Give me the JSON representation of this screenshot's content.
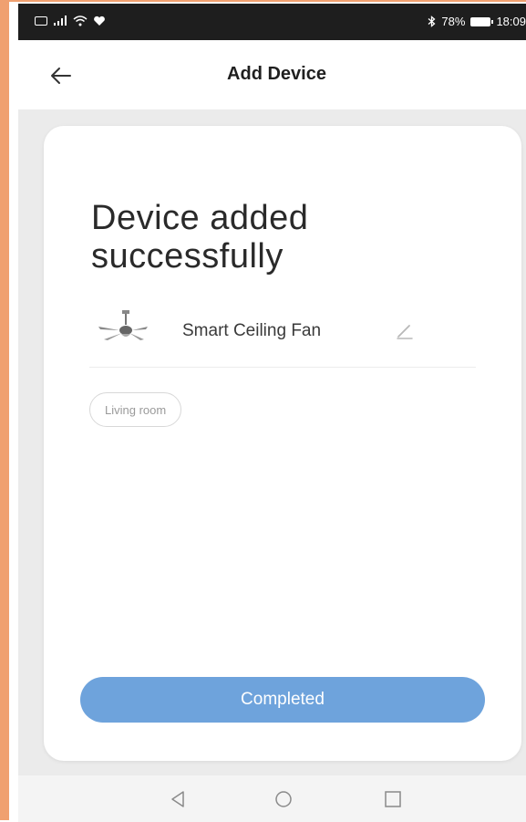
{
  "status_bar": {
    "battery_text": "78%",
    "time": "18:09",
    "icons": [
      "sim-icon",
      "signal-icon",
      "wifi-icon",
      "heart-icon",
      "bluetooth-icon",
      "battery-icon"
    ]
  },
  "header": {
    "back_icon": "arrow-left-icon",
    "title": "Add Device"
  },
  "card": {
    "heading": "Device added successfully",
    "device": {
      "icon": "ceiling-fan-icon",
      "name": "Smart Ceiling Fan",
      "edit_icon": "pencil-icon"
    },
    "room": "Living room",
    "completed_label": "Completed"
  },
  "nav_bar": {
    "icons": [
      "back-triangle-icon",
      "home-circle-icon",
      "recents-square-icon"
    ]
  },
  "colors": {
    "accent": "#6ea3dc",
    "background": "#ebebeb",
    "card": "#ffffff",
    "status_bar": "#1e1e1e"
  }
}
